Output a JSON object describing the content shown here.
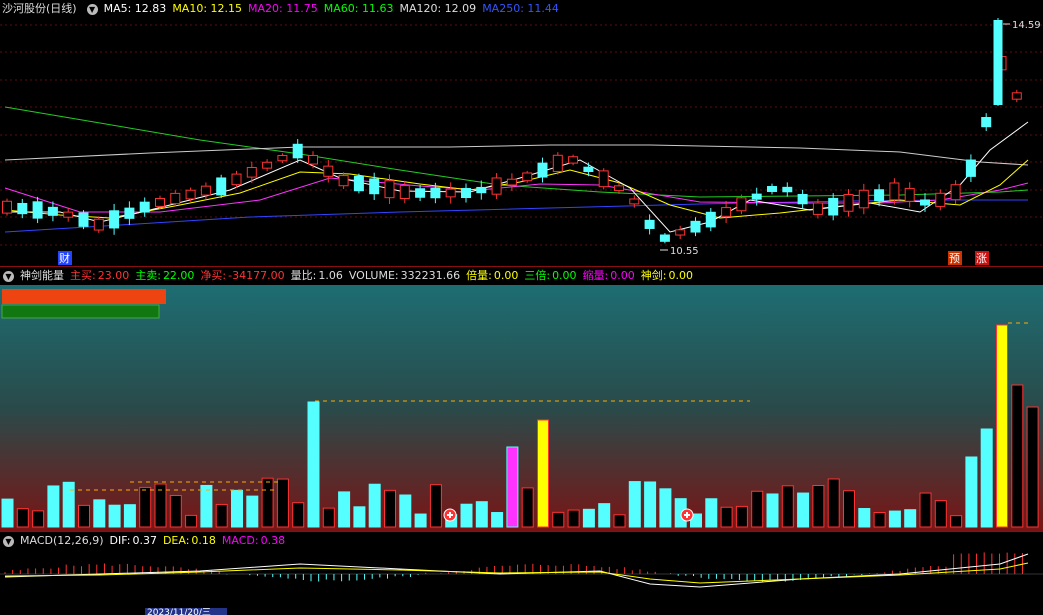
{
  "main": {
    "title": "沙河股份(日线)",
    "indicators": [
      {
        "label": "MA5: 12.83",
        "color": "#ffffff"
      },
      {
        "label": "MA10: 12.15",
        "color": "#ffff00"
      },
      {
        "label": "MA20: 11.75",
        "color": "#ff00ff"
      },
      {
        "label": "MA60: 11.63",
        "color": "#00ff00"
      },
      {
        "label": "MA120: 12.09",
        "color": "#dddddd"
      },
      {
        "label": "MA250: 11.44",
        "color": "#3355ff"
      }
    ],
    "high_label": "14.59",
    "low_label": "10.55",
    "tags": [
      "财",
      "预",
      "涨"
    ]
  },
  "volume_panel": {
    "title": "神剑能量",
    "items": [
      {
        "label": "主买:",
        "value": "23.00",
        "color": "#ff3333"
      },
      {
        "label": "主卖:",
        "value": "22.00",
        "color": "#00ff00"
      },
      {
        "label": "净买:",
        "value": "-34177.00",
        "color": "#ff3333"
      },
      {
        "label": "量比:",
        "value": "1.06",
        "color": "#dddddd"
      },
      {
        "label": "VOLUME:",
        "value": "332231.66",
        "color": "#dddddd"
      },
      {
        "label": "倍量:",
        "value": "0.00",
        "color": "#ffff00"
      },
      {
        "label": "三倍:",
        "value": "0.00",
        "color": "#00ff00"
      },
      {
        "label": "缩量:",
        "value": "0.00",
        "color": "#ff00ff"
      },
      {
        "label": "神剑:",
        "value": "0.00",
        "color": "#ffff00"
      }
    ]
  },
  "macd_panel": {
    "title": "MACD(12,26,9)",
    "items": [
      {
        "label": "DIF:",
        "value": "0.37",
        "color": "#ffffff"
      },
      {
        "label": "DEA:",
        "value": "0.18",
        "color": "#ffff00"
      },
      {
        "label": "MACD:",
        "value": "0.38",
        "color": "#ff00ff"
      }
    ],
    "date_label": "2023/11/20/三"
  }
}
